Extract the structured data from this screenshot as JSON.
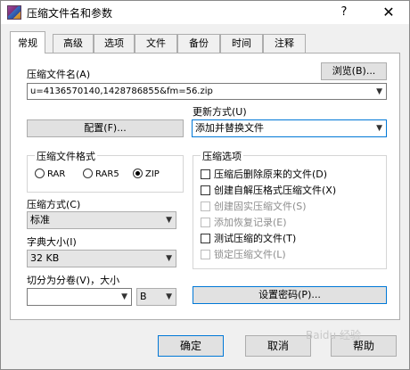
{
  "window": {
    "title": "压缩文件名和参数",
    "help_glyph": "?",
    "close_glyph": "✕"
  },
  "tabs": [
    {
      "label": "常规",
      "active": true
    },
    {
      "label": "高级"
    },
    {
      "label": "选项"
    },
    {
      "label": "文件"
    },
    {
      "label": "备份"
    },
    {
      "label": "时间"
    },
    {
      "label": "注释"
    }
  ],
  "archive": {
    "label": "压缩文件名(A)",
    "browse_label": "浏览(B)...",
    "filename": "u=4136570140,1428786855&fm=56.zip"
  },
  "profile_button": "配置(F)...",
  "update_mode": {
    "label": "更新方式(U)",
    "selected": "添加并替换文件"
  },
  "format": {
    "title": "压缩文件格式",
    "options": [
      "RAR",
      "RAR5",
      "ZIP"
    ],
    "selected": "ZIP"
  },
  "method": {
    "label": "压缩方式(C)",
    "selected": "标准"
  },
  "dictionary": {
    "label": "字典大小(I)",
    "selected": "32 KB"
  },
  "split": {
    "label": "切分为分卷(V)，大小",
    "value": "",
    "unit": "B"
  },
  "compression_options": {
    "title": "压缩选项",
    "items": [
      {
        "label": "压缩后删除原来的文件(D)",
        "enabled": true,
        "checked": false
      },
      {
        "label": "创建自解压格式压缩文件(X)",
        "enabled": true,
        "checked": false
      },
      {
        "label": "创建固实压缩文件(S)",
        "enabled": false,
        "checked": false
      },
      {
        "label": "添加恢复记录(E)",
        "enabled": false,
        "checked": false
      },
      {
        "label": "测试压缩的文件(T)",
        "enabled": true,
        "checked": false
      },
      {
        "label": "锁定压缩文件(L)",
        "enabled": false,
        "checked": false
      }
    ]
  },
  "password_button": "设置密码(P)...",
  "footer": {
    "ok": "确定",
    "cancel": "取消",
    "help": "帮助"
  },
  "watermark": "Baidu 经验",
  "icons": {
    "app": "winrar-icon",
    "dropdown": "chevron-down-icon"
  },
  "colors": {
    "focus_border": "#0078d7",
    "button_face": "#e1e1e1"
  }
}
